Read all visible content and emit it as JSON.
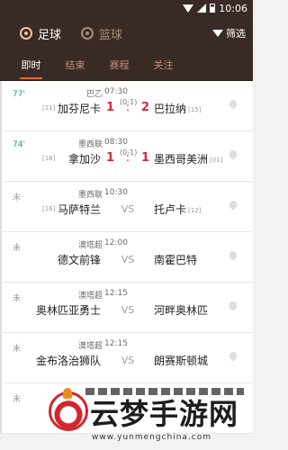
{
  "status_bar": {
    "time": "10:06"
  },
  "header": {
    "sports": [
      {
        "label": "足球",
        "active": true
      },
      {
        "label": "篮球",
        "active": false
      }
    ],
    "filter_label": "筛选"
  },
  "tabs": [
    "即时",
    "结束",
    "赛程",
    "关注"
  ],
  "matches": [
    {
      "minute": "77'",
      "live": true,
      "league": "巴乙",
      "time": "07:30",
      "halftime": "(0-1)",
      "home_rank": "[11]",
      "home": "加芬尼卡",
      "home_score": "1",
      "away_score": "2",
      "away": "巴拉纳",
      "away_rank": "[15]"
    },
    {
      "minute": "74'",
      "live": true,
      "league": "墨西联",
      "time": "08:30",
      "halftime": "(0-1)",
      "home_rank": "[18]",
      "home": "拿加沙",
      "home_score": "1",
      "away_score": "1",
      "away": "墨西哥美洲",
      "away_rank": "[01]"
    },
    {
      "minute": "未",
      "live": false,
      "league": "墨西联",
      "time": "10:30",
      "halftime": "",
      "home_rank": "[16]",
      "home": "马萨特兰",
      "vs": "VS",
      "away": "托卢卡",
      "away_rank": "[12]"
    },
    {
      "minute": "未",
      "live": false,
      "league": "澳塔超",
      "time": "12:00",
      "halftime": "",
      "home_rank": "",
      "home": "德文前锋",
      "vs": "VS",
      "away": "南霍巴特",
      "away_rank": ""
    },
    {
      "minute": "未",
      "live": false,
      "league": "澳塔超",
      "time": "12:15",
      "halftime": "",
      "home_rank": "",
      "home": "奥林匹亚勇士",
      "vs": "VS",
      "away": "河畔奥林匹",
      "away_rank": ""
    },
    {
      "minute": "未",
      "live": false,
      "league": "澳塔超",
      "time": "12:15",
      "halftime": "",
      "home_rank": "",
      "home": "金布洛治狮队",
      "vs": "VS",
      "away": "朗赛斯顿城",
      "away_rank": ""
    },
    {
      "minute": "未",
      "live": false,
      "league": "",
      "time": "",
      "halftime": "",
      "home_rank": "",
      "home": "",
      "vs": "",
      "away": "",
      "away_rank": ""
    }
  ],
  "watermark": {
    "title": "云梦手游网",
    "url": "www.yunmengchina.com"
  }
}
